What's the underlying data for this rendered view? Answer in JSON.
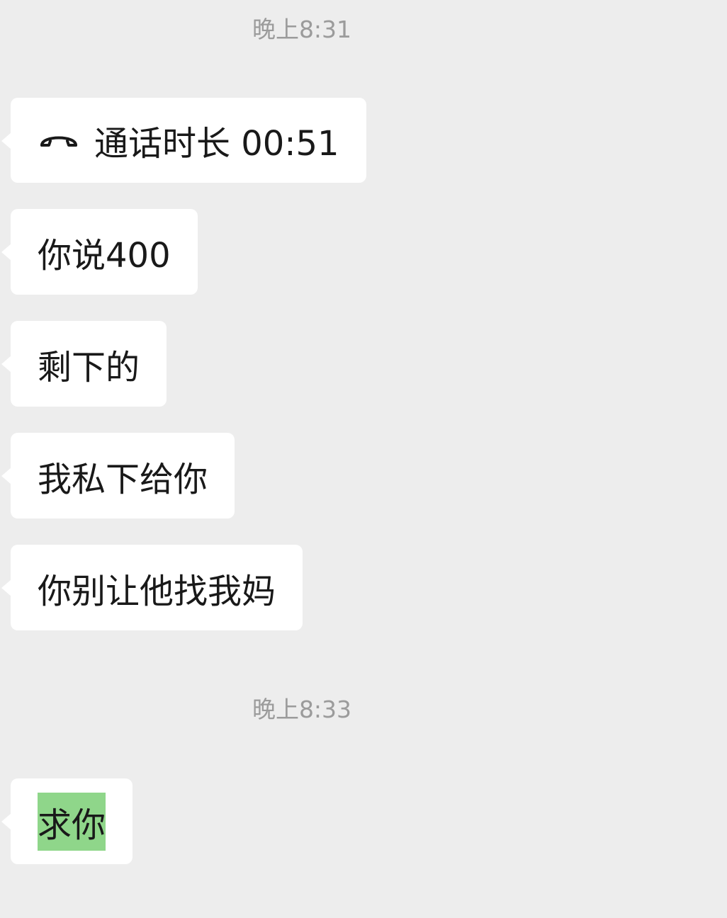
{
  "chat": {
    "timestamps": [
      "晚上8:31",
      "晚上8:33"
    ],
    "messages": [
      {
        "type": "call",
        "icon": "phone-hangup-icon",
        "text": "通话时长 00:51"
      },
      {
        "type": "text",
        "text": "你说400"
      },
      {
        "type": "text",
        "text": "剩下的"
      },
      {
        "type": "text",
        "text": "我私下给你"
      },
      {
        "type": "text",
        "text": "你别让他找我妈"
      },
      {
        "type": "text",
        "text": "求你",
        "highlighted": true
      }
    ]
  },
  "colors": {
    "background": "#ededed",
    "bubble": "#ffffff",
    "text": "#191919",
    "timestamp": "#9b9b9b",
    "highlight": "#8fd68a"
  }
}
